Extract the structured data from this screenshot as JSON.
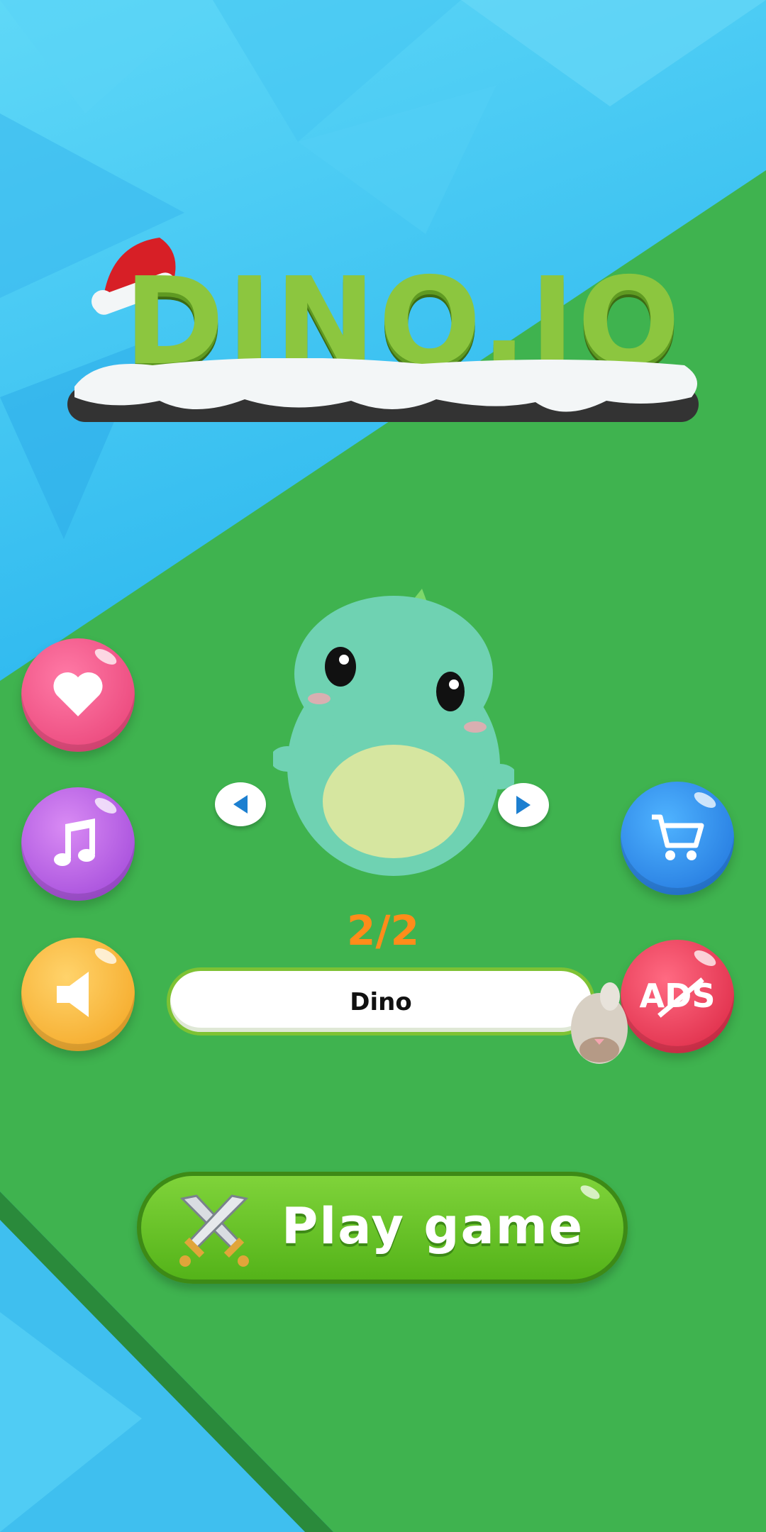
{
  "game": {
    "logo_text": "DINO.IO",
    "skin_counter": "2/2",
    "skin_name": "Dino",
    "play_label": "Play game",
    "ads_label": "ADS"
  },
  "side_buttons": {
    "left": [
      "heart-icon",
      "music-note-icon",
      "speaker-icon"
    ],
    "right": [
      "cart-icon",
      "no-ads-icon"
    ]
  },
  "colors": {
    "water": "#2fb9ef",
    "grass": "#3fb34f",
    "logo_green": "#8cc63f",
    "counter_orange": "#ff8c1a",
    "play_green": "#5fc01f",
    "heart_btn": "#f0507f",
    "music_btn": "#b65ee6",
    "sound_btn": "#f8b83a",
    "cart_btn": "#2b86e6",
    "ads_btn": "#e43450"
  }
}
